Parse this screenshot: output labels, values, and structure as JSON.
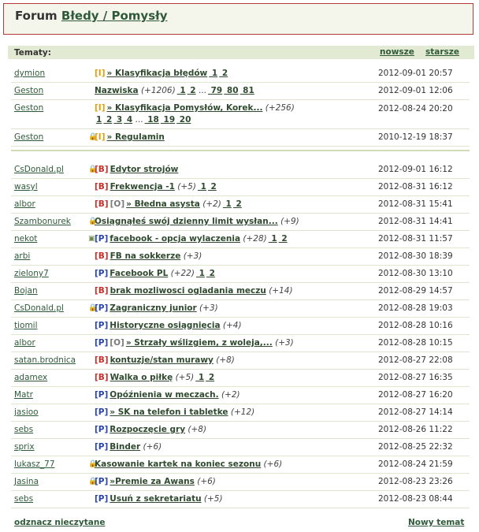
{
  "header": {
    "prefix": "Forum",
    "forum": "Błedy / Pomysły"
  },
  "bar": {
    "label": "Tematy:",
    "newer": "nowsze",
    "older": "starsze"
  },
  "pinned": [
    {
      "author": "dymion",
      "icon": "",
      "tags": [
        "I"
      ],
      "title": "» Klasyfikacja błędów",
      "count": "",
      "pages": [
        "1",
        "2"
      ],
      "date": "2012-09-01 20:57"
    },
    {
      "author": "Geston",
      "icon": "",
      "tags": [],
      "title": "Nazwiska",
      "count": "(+1206)",
      "pages": [
        "1",
        "2",
        "...",
        "79",
        "80",
        "81"
      ],
      "date": "2012-09-01 12:06"
    },
    {
      "author": "Geston",
      "icon": "",
      "tags": [
        "I"
      ],
      "title": "» Klasyfikacja Pomysłów, Korek...",
      "count": "(+256)",
      "pages": [
        "1",
        "2",
        "3",
        "4",
        "...",
        "18",
        "19",
        "20"
      ],
      "date": "2012-08-24 20:20",
      "twoLine": true
    },
    {
      "author": "Geston",
      "icon": "lock-icon",
      "tags": [
        "I"
      ],
      "title": "» Regulamin",
      "count": "",
      "pages": [],
      "date": "2010-12-19 18:37"
    }
  ],
  "topics": [
    {
      "author": "CsDonald.pl",
      "icon": "lock-icon",
      "tags": [
        "B"
      ],
      "title": "Edytor strojów",
      "count": "",
      "pages": [],
      "date": "2012-09-01 16:12"
    },
    {
      "author": "wasyl",
      "icon": "",
      "tags": [
        "B"
      ],
      "title": "Frekwencja -1",
      "count": "(+5)",
      "pages": [
        "1",
        "2"
      ],
      "date": "2012-08-31 16:12"
    },
    {
      "author": "albor",
      "icon": "",
      "tags": [
        "B",
        "O"
      ],
      "title": "» Błedna asysta",
      "count": "(+2)",
      "pages": [
        "1",
        "2"
      ],
      "date": "2012-08-31 15:41"
    },
    {
      "author": "Szambonurek",
      "icon": "lock-icon",
      "tags": [],
      "title": "Osiągnąłeś swój dzienny limit wysłan...",
      "count": "(+9)",
      "pages": [],
      "date": "2012-08-31 14:41"
    },
    {
      "author": "nekot",
      "icon": "bubble-icon",
      "tags": [
        "P"
      ],
      "title": "facebook - opcja wylaczenia",
      "count": "(+28)",
      "pages": [
        "1",
        "2"
      ],
      "date": "2012-08-31 11:57"
    },
    {
      "author": "arbi",
      "icon": "",
      "tags": [
        "B"
      ],
      "title": "FB na sokkerze",
      "count": "(+3)",
      "pages": [],
      "date": "2012-08-30 18:39"
    },
    {
      "author": "zielony7",
      "icon": "",
      "tags": [
        "P"
      ],
      "title": "Facebook PL",
      "count": "(+22)",
      "pages": [
        "1",
        "2"
      ],
      "date": "2012-08-30 13:10"
    },
    {
      "author": "Bojan",
      "icon": "",
      "tags": [
        "B"
      ],
      "title": "brak mozliwosci ogladania meczu",
      "count": "(+14)",
      "pages": [],
      "date": "2012-08-29 14:57"
    },
    {
      "author": "CsDonald.pl",
      "icon": "lock-icon",
      "tags": [
        "P"
      ],
      "title": "Zagraniczny junior",
      "count": "(+3)",
      "pages": [],
      "date": "2012-08-28 19:03"
    },
    {
      "author": "tiomil",
      "icon": "",
      "tags": [
        "P"
      ],
      "title": "Historyczne osiągnięcia",
      "count": "(+4)",
      "pages": [],
      "date": "2012-08-28 10:16"
    },
    {
      "author": "albor",
      "icon": "",
      "tags": [
        "P",
        "O"
      ],
      "title": "» Strzały wślizgiem, z woleja,...",
      "count": "(+3)",
      "pages": [],
      "date": "2012-08-28 10:15"
    },
    {
      "author": "satan.brodnica",
      "icon": "",
      "tags": [
        "B"
      ],
      "title": "kontuzje/stan murawy",
      "count": "(+8)",
      "pages": [],
      "date": "2012-08-27 22:08"
    },
    {
      "author": "adamex",
      "icon": "",
      "tags": [
        "B"
      ],
      "title": "Walka o piłkę",
      "count": "(+5)",
      "pages": [
        "1",
        "2"
      ],
      "date": "2012-08-27 16:35"
    },
    {
      "author": "Matr",
      "icon": "",
      "tags": [
        "P"
      ],
      "title": "Opóźnienia w meczach.",
      "count": "(+2)",
      "pages": [],
      "date": "2012-08-27 16:20"
    },
    {
      "author": "jasioo",
      "icon": "",
      "tags": [
        "P"
      ],
      "title": "» SK na telefon i tabletke",
      "count": "(+12)",
      "pages": [],
      "date": "2012-08-27 14:14"
    },
    {
      "author": "sebs",
      "icon": "",
      "tags": [
        "P"
      ],
      "title": "Rozpoczęcie gry",
      "count": "(+8)",
      "pages": [],
      "date": "2012-08-26 11:22"
    },
    {
      "author": "sprix",
      "icon": "",
      "tags": [
        "P"
      ],
      "title": "Binder",
      "count": "(+6)",
      "pages": [],
      "date": "2012-08-25 22:32"
    },
    {
      "author": "lukasz_77",
      "icon": "lock-icon",
      "tags": [],
      "title": "Kasowanie kartek na koniec sezonu",
      "count": "(+6)",
      "pages": [],
      "date": "2012-08-24 21:59"
    },
    {
      "author": "Jasina",
      "icon": "lock-icon",
      "tags": [
        "P"
      ],
      "title": "»Premie za Awans",
      "count": "(+6)",
      "pages": [],
      "date": "2012-08-23 23:26"
    },
    {
      "author": "sebs",
      "icon": "",
      "tags": [
        "P"
      ],
      "title": "Usuń z sekretariatu",
      "count": "(+5)",
      "pages": [],
      "date": "2012-08-23 08:44"
    }
  ],
  "footer": {
    "mark_read": "odznacz nieczytane",
    "new_topic": "Nowy temat"
  },
  "colors": {
    "accent": "#2f5a3a",
    "bar": "#e3ead3",
    "header_bg": "#f4f6ec",
    "header_border": "#b43a3a"
  }
}
